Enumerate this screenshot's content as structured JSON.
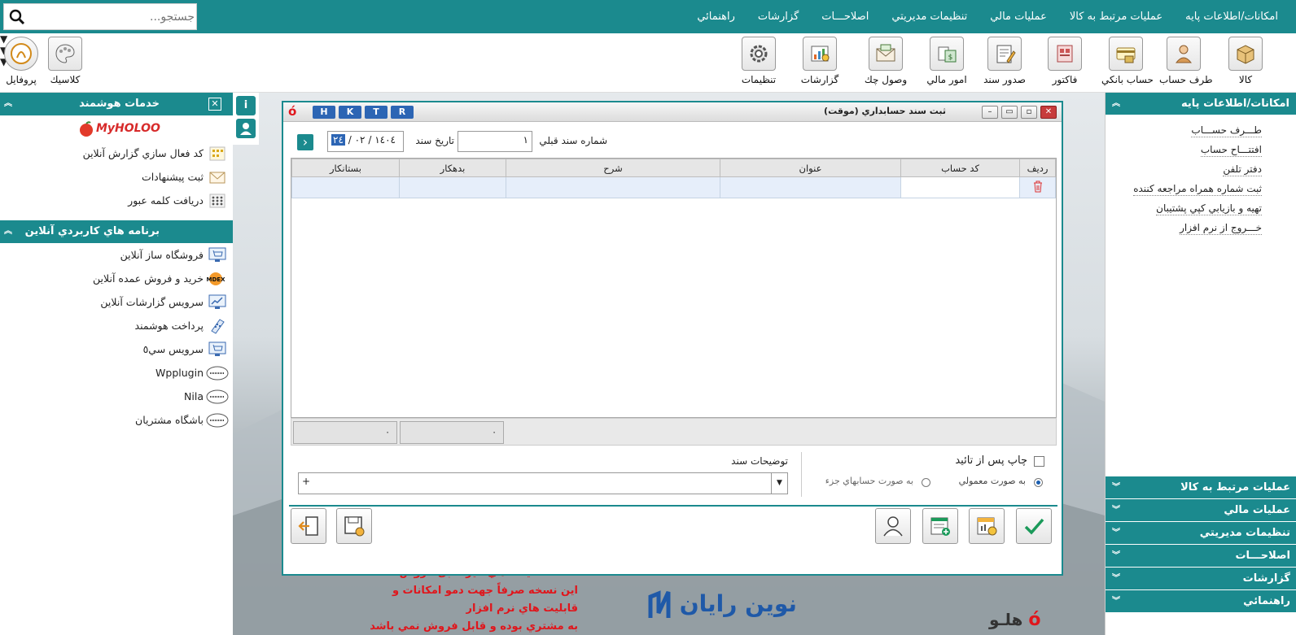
{
  "menubar": {
    "items": [
      "امكانات/اطلاعات پايه",
      "عمليات مرتبط به كالا",
      "عمليات مالي",
      "تنظيمات مديريتي",
      "اصلاحـــات",
      "گزارشات",
      "راهنمائي"
    ],
    "search_placeholder": "جستجو..."
  },
  "toolbar": {
    "items": [
      "كالا",
      "طرف حساب",
      "حساب بانكي",
      "فاكتور",
      "صدور سند",
      "امور مالي",
      "وصول چك",
      "گزارشات",
      "تنظيمات"
    ],
    "classic": "كلاسيك",
    "profile": "پروفايل"
  },
  "smart_services": {
    "title": "خدمات هوشمند",
    "logo": "MyHOLOO",
    "items": [
      "كد فعال سازي گزارش آنلاين",
      "ثبت پيشنهادات",
      "دريافت كلمه عبور"
    ]
  },
  "online_apps": {
    "title": "برنامه هاي كاربردي آنلاين",
    "items": [
      "فروشگاه ساز آنلاين",
      "خريد و فروش عمده آنلاين",
      "سرويس گزارشات آنلاين",
      "پرداخت هوشمند",
      "سرويس سي٥",
      "Wpplugin",
      "Nila",
      "باشگاه مشتريان"
    ],
    "mdex": "MDEX"
  },
  "side_tabs": {
    "info": "i"
  },
  "dialog": {
    "title": "ثبت سند حسابداري (موقت)",
    "hotkeys": [
      "H",
      "K",
      "T",
      "R"
    ],
    "prev_doc_label": "شماره سند قبلي",
    "prev_doc_value": "١",
    "date_label": "تاريخ سند",
    "date_year": "١٤٠٤",
    "date_month": "٠٢",
    "date_day": "٢٤",
    "nav_next": "›",
    "columns": [
      "رديف",
      "كد حساب",
      "عنوان",
      "شرح",
      "بدهكار",
      "بستانكار"
    ],
    "total_debit": "٠",
    "total_credit": "٠",
    "print_after_confirm": "چاپ پس از تائيد",
    "radio_normal": "به صورت معمولي",
    "radio_partial": "به صورت حسابهاي جزء",
    "description_label": "توضيحات سند",
    "description_value": "+"
  },
  "right_panel": {
    "head": "امكانات/اطلاعات پايه",
    "items": [
      "طـــرف حســـاب",
      "افتتـــاح حساب",
      "دفتر تلفن",
      "ثبت شماره همراه مراجعه كننده",
      "تهيه و بازيابي كپي پشتيبان",
      "خـــروج از نرم افزار"
    ],
    "sections": [
      "عمليات مرتبط به كالا",
      "عمليات مالي",
      "تنظيمات مديريتي",
      "اصلاحـــات",
      "گزارشات",
      "راهنمائي"
    ]
  },
  "watermark": {
    "line1": "نسخه نمايشگاهي غير قابل فروش",
    "line2": "اين نسخه صرفاً جهت دمو امكانات و قابليت هاي نرم افزار",
    "line3": "به مشتري بوده و قابل فروش نمي باشد",
    "logo_novin": "نوين رايان",
    "logo_holoo": "هلـو"
  },
  "colors": {
    "teal": "#1b8a8e",
    "red": "#e0161c",
    "blue": "#1f59a8"
  }
}
